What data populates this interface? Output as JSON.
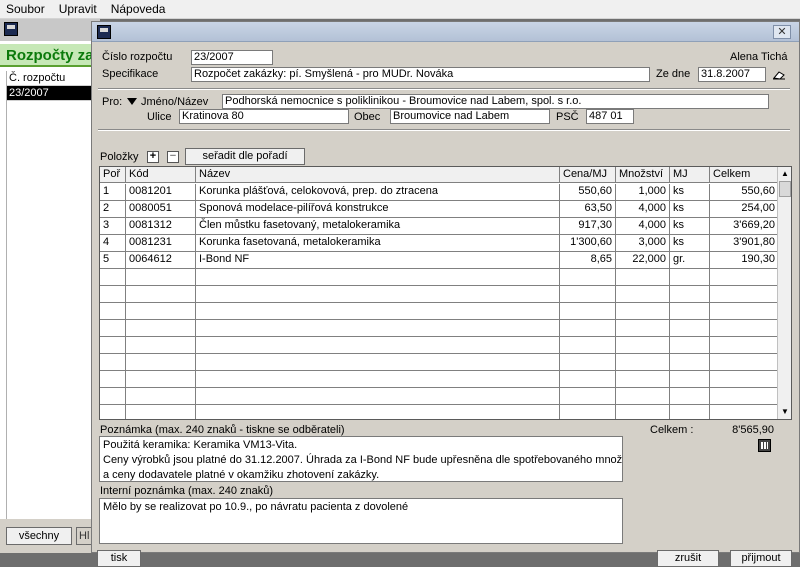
{
  "menu": [
    "Soubor",
    "Upravit",
    "Nápoveda"
  ],
  "background_window": {
    "title": "Rozpočty zak",
    "list_header": "Č. rozpočtu",
    "items": [
      "23/2007"
    ],
    "all_button": "všechny",
    "second_button": "Hl"
  },
  "dialog": {
    "close_glyph": "✕",
    "budget_number_label": "Číslo rozpočtu",
    "budget_number": "23/2007",
    "user": "Alena Tichá",
    "spec_label": "Specifikace",
    "spec": "Rozpočet zakázky: pí. Smyšlená - pro MUDr. Nováka",
    "date_label": "Ze dne",
    "date": "31.8.2007",
    "pro_label": "Pro:",
    "name_label": "Jméno/Název",
    "name": "Podhorská nemocnice s poliklinikou - Broumovice nad Labem, spol. s r.o.",
    "street_label": "Ulice",
    "street": "Kratinova 80",
    "city_label": "Obec",
    "city": "Broumovice nad Labem",
    "zip_label": "PSČ",
    "zip": "487 01",
    "items_label": "Položky",
    "add_glyph": "+",
    "remove_glyph": "−",
    "sort_button": "seřadit dle pořadí",
    "columns": [
      "Poř",
      "Kód",
      "Název",
      "Cena/MJ",
      "Množství",
      "MJ",
      "Celkem"
    ],
    "rows": [
      [
        "1",
        "0081201",
        "Korunka plášťová, celokovová, prep. do ztracena",
        "550,60",
        "1,000",
        "ks",
        "550,60"
      ],
      [
        "2",
        "0080051",
        "Sponová modelace-pilířová konstrukce",
        "63,50",
        "4,000",
        "ks",
        "254,00"
      ],
      [
        "3",
        "0081312",
        "Člen můstku fasetovaný, metalokeramika",
        "917,30",
        "4,000",
        "ks",
        "3'669,20"
      ],
      [
        "4",
        "0081231",
        "Korunka fasetovaná, metalokeramika",
        "1'300,60",
        "3,000",
        "ks",
        "3'901,80"
      ],
      [
        "5",
        "0064612",
        "I-Bond NF",
        "8,65",
        "22,000",
        "gr.",
        "190,30"
      ]
    ],
    "note_label": "Poznámka (max. 240 znaků - tiskne se odběrateli)",
    "note_lines": [
      "Použitá keramika: Keramika VM13-Vita.",
      "Ceny výrobků jsou platné do 31.12.2007. Úhrada za I-Bond NF bude upřesněna dle spotřebovaného množství",
      "a ceny dodavatele platné v okamžiku zhotovení zakázky."
    ],
    "total_label": "Celkem :",
    "total": "8'565,90",
    "internal_note_label": "Interní poznámka (max. 240 znaků)",
    "internal_note": "Mělo by se realizovat po 10.9., po návratu pacienta z dovolené",
    "print_button": "tisk",
    "cancel_button": "zrušit",
    "accept_button": "přijmout"
  }
}
